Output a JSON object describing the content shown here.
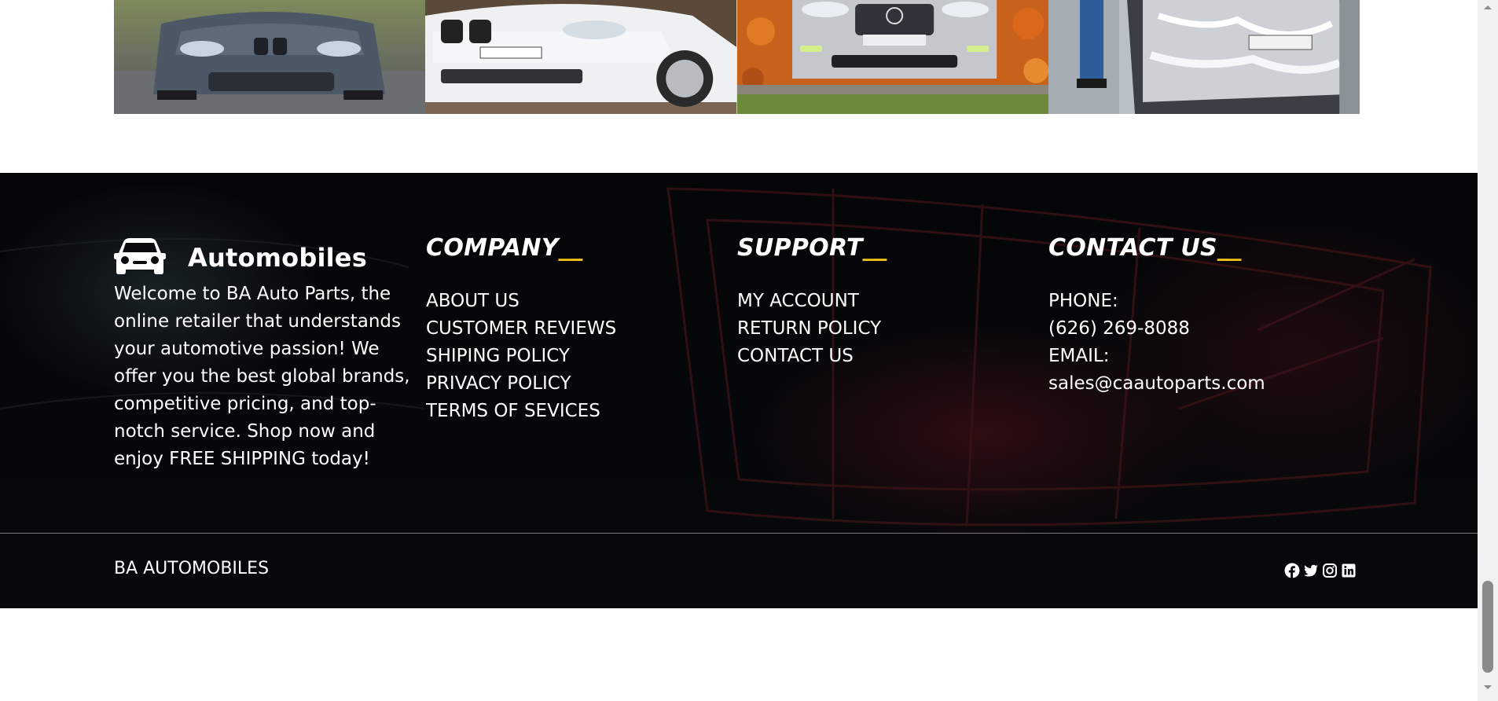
{
  "gallery": {
    "images": [
      {
        "icon": "car-photo-gray-bmw"
      },
      {
        "icon": "car-photo-white-bmw"
      },
      {
        "icon": "car-photo-silver-mercedes"
      },
      {
        "icon": "car-photo-car-wash"
      }
    ]
  },
  "footer": {
    "brand": {
      "logo_icon": "car-front-icon",
      "name": "Automobiles",
      "description": "Welcome to BA Auto Parts, the online retailer that understands your automotive passion! We offer you the best global brands, competitive pricing, and top-notch service. Shop now and enjoy FREE SHIPPING today!"
    },
    "company": {
      "title": "COMPANY",
      "accent": "__",
      "links": [
        "ABOUT US",
        "CUSTOMER REVIEWS",
        "SHIPING POLICY",
        "PRIVACY POLICY",
        "TERMS OF SEVICES"
      ]
    },
    "support": {
      "title": "SUPPORT",
      "accent": "__",
      "links": [
        "MY ACCOUNT",
        "RETURN POLICY",
        "CONTACT US"
      ]
    },
    "contact": {
      "title": "CONTACT US",
      "accent": "__",
      "phone_label": "PHONE:",
      "phone": "(626) 269-8088",
      "email_label": "EMAIL:",
      "email": "sales@caautoparts.com"
    },
    "bottom": {
      "copyright": "BA AUTOMOBILES",
      "socials": [
        "facebook-icon",
        "twitter-icon",
        "instagram-icon",
        "linkedin-icon"
      ]
    },
    "colors": {
      "background": "#050608",
      "text": "#ffffff",
      "accent": "#f4c21a"
    }
  }
}
